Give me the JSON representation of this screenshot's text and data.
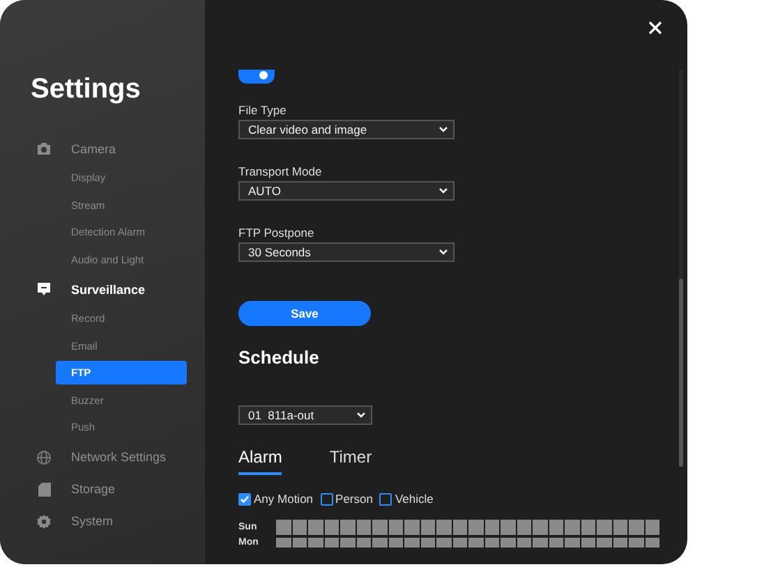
{
  "sidebar": {
    "title": "Settings",
    "sections": [
      {
        "label": "Camera",
        "selected": false,
        "children": [
          {
            "label": "Display",
            "selected": false
          },
          {
            "label": "Stream",
            "selected": false
          },
          {
            "label": "Detection Alarm",
            "selected": false
          },
          {
            "label": "Audio and Light",
            "selected": false
          }
        ]
      },
      {
        "label": "Surveillance",
        "selected": true,
        "children": [
          {
            "label": "Record",
            "selected": false
          },
          {
            "label": "Email",
            "selected": false
          },
          {
            "label": "FTP",
            "selected": true
          },
          {
            "label": "Buzzer",
            "selected": false
          },
          {
            "label": "Push",
            "selected": false
          }
        ]
      },
      {
        "label": "Network Settings",
        "selected": false
      },
      {
        "label": "Storage",
        "selected": false
      },
      {
        "label": "System",
        "selected": false
      }
    ]
  },
  "ftp": {
    "toggle": {
      "on": true
    },
    "fields": [
      {
        "label": "File Type",
        "value": "Clear video and image"
      },
      {
        "label": "Transport Mode",
        "value": "AUTO"
      },
      {
        "label": "FTP Postpone",
        "value": "30 Seconds"
      }
    ],
    "save_button": "Save"
  },
  "schedule": {
    "title": "Schedule",
    "channel": "01  811a-out",
    "tabs": [
      {
        "label": "Alarm",
        "selected": true
      },
      {
        "label": "Timer",
        "selected": false
      }
    ],
    "filters": [
      {
        "label": "Any Motion",
        "checked": true
      },
      {
        "label": "Person",
        "checked": false
      },
      {
        "label": "Vehicle",
        "checked": false
      }
    ],
    "days": [
      {
        "label": "Sun"
      },
      {
        "label": "Mon"
      }
    ]
  }
}
